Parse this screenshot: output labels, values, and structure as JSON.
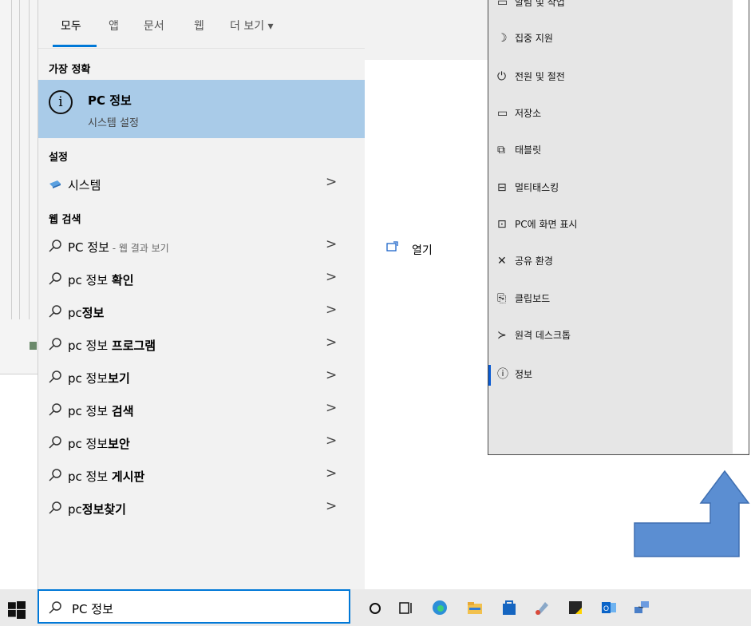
{
  "tabs": [
    "모두",
    "앱",
    "문서",
    "웹",
    "더 보기 ▾"
  ],
  "best_match": {
    "header": "가장 정확",
    "title": "PC 정보",
    "subtitle": "시스템 설정",
    "icon": "info-icon"
  },
  "settings_section": {
    "header": "설정",
    "items": [
      {
        "label": "시스템",
        "icon": "laptop-icon"
      }
    ]
  },
  "web_section": {
    "header": "웹 검색",
    "items": [
      {
        "plain": "PC 정보",
        "bold": "",
        "suffix": " - 웹 결과 보기"
      },
      {
        "plain": "pc 정보 ",
        "bold": "확인",
        "suffix": ""
      },
      {
        "plain": "pc",
        "bold": "정보",
        "suffix": ""
      },
      {
        "plain": "pc 정보 ",
        "bold": "프로그램",
        "suffix": ""
      },
      {
        "plain": "pc 정보",
        "bold": "보기",
        "suffix": ""
      },
      {
        "plain": "pc 정보 ",
        "bold": "검색",
        "suffix": ""
      },
      {
        "plain": "pc 정보",
        "bold": "보안",
        "suffix": ""
      },
      {
        "plain": "pc 정보 ",
        "bold": "게시판",
        "suffix": ""
      },
      {
        "plain": "pc",
        "bold": "정보찾기",
        "suffix": ""
      }
    ]
  },
  "preview": {
    "open_label": "열기"
  },
  "settings_flyout": {
    "items": [
      {
        "label": "알림 및 작업",
        "glyph": "▭"
      },
      {
        "label": "집중 지원",
        "glyph": "☽"
      },
      {
        "label": "전원 및 절전",
        "glyph": "⏻"
      },
      {
        "label": "저장소",
        "glyph": "▭"
      },
      {
        "label": "태블릿",
        "glyph": "⧉"
      },
      {
        "label": "멀티태스킹",
        "glyph": "⊟"
      },
      {
        "label": "PC에 화면 표시",
        "glyph": "⊡"
      },
      {
        "label": "공유 환경",
        "glyph": "✕"
      },
      {
        "label": "클립보드",
        "glyph": "⎘"
      },
      {
        "label": "원격 데스크톱",
        "glyph": "≻"
      },
      {
        "label": "정보",
        "glyph": "ⓘ"
      }
    ]
  },
  "taskbar": {
    "search_value": "PC 정보",
    "icons": [
      "windows-logo-icon",
      "cortana-icon",
      "task-view-icon",
      "edge-icon",
      "file-explorer-icon",
      "store-icon",
      "paint-icon",
      "sticky-notes-icon",
      "outlook-icon",
      "network-icon"
    ]
  },
  "colors": {
    "accent": "#0078d7",
    "selection": "#a9cbe8",
    "arrow": "#5b8ed2"
  }
}
